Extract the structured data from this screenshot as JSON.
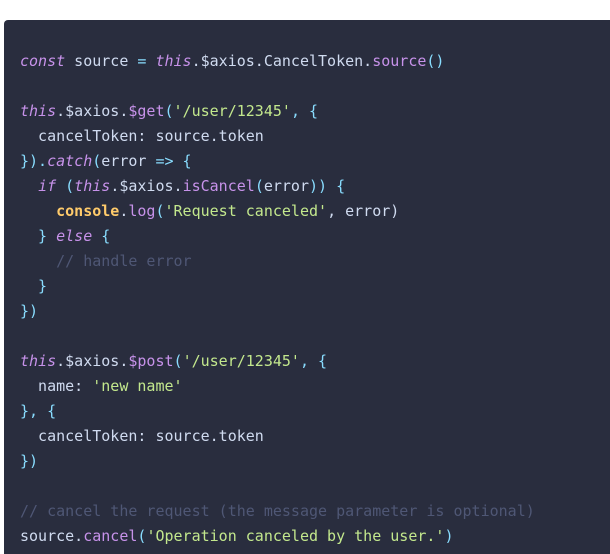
{
  "code": {
    "lines": [
      [
        {
          "t": "const",
          "c": "kw"
        },
        {
          "t": " source ",
          "c": "plain"
        },
        {
          "t": "=",
          "c": "op"
        },
        {
          "t": " ",
          "c": "plain"
        },
        {
          "t": "this",
          "c": "this"
        },
        {
          "t": ".$axios.CancelToken.",
          "c": "plain"
        },
        {
          "t": "source",
          "c": "fn"
        },
        {
          "t": "()",
          "c": "punc"
        }
      ],
      [],
      [
        {
          "t": "this",
          "c": "this"
        },
        {
          "t": ".$axios.",
          "c": "plain"
        },
        {
          "t": "$get",
          "c": "fn"
        },
        {
          "t": "(",
          "c": "punc"
        },
        {
          "t": "'/user/12345'",
          "c": "str"
        },
        {
          "t": ", {",
          "c": "punc"
        }
      ],
      [
        {
          "t": "  cancelToken: source.token",
          "c": "plain"
        }
      ],
      [
        {
          "t": "}).",
          "c": "punc"
        },
        {
          "t": "catch",
          "c": "kw"
        },
        {
          "t": "(",
          "c": "punc"
        },
        {
          "t": "error ",
          "c": "plain"
        },
        {
          "t": "=>",
          "c": "op"
        },
        {
          "t": " {",
          "c": "punc"
        }
      ],
      [
        {
          "t": "  ",
          "c": "plain"
        },
        {
          "t": "if",
          "c": "kw"
        },
        {
          "t": " (",
          "c": "punc"
        },
        {
          "t": "this",
          "c": "this"
        },
        {
          "t": ".$axios.",
          "c": "plain"
        },
        {
          "t": "isCancel",
          "c": "fn"
        },
        {
          "t": "(",
          "c": "punc"
        },
        {
          "t": "error",
          "c": "plain"
        },
        {
          "t": ")) {",
          "c": "punc"
        }
      ],
      [
        {
          "t": "    ",
          "c": "plain"
        },
        {
          "t": "console",
          "c": "console"
        },
        {
          "t": ".",
          "c": "plain"
        },
        {
          "t": "log",
          "c": "fn"
        },
        {
          "t": "(",
          "c": "punc"
        },
        {
          "t": "'Request canceled'",
          "c": "str"
        },
        {
          "t": ", error)",
          "c": "plain"
        }
      ],
      [
        {
          "t": "  } ",
          "c": "punc"
        },
        {
          "t": "else",
          "c": "kw"
        },
        {
          "t": " {",
          "c": "punc"
        }
      ],
      [
        {
          "t": "    // handle error",
          "c": "comment"
        }
      ],
      [
        {
          "t": "  }",
          "c": "punc"
        }
      ],
      [
        {
          "t": "})",
          "c": "punc"
        }
      ],
      [],
      [
        {
          "t": "this",
          "c": "this"
        },
        {
          "t": ".$axios.",
          "c": "plain"
        },
        {
          "t": "$post",
          "c": "fn"
        },
        {
          "t": "(",
          "c": "punc"
        },
        {
          "t": "'/user/12345'",
          "c": "str"
        },
        {
          "t": ", {",
          "c": "punc"
        }
      ],
      [
        {
          "t": "  name: ",
          "c": "plain"
        },
        {
          "t": "'new name'",
          "c": "str"
        }
      ],
      [
        {
          "t": "}, {",
          "c": "punc"
        }
      ],
      [
        {
          "t": "  cancelToken: source.token",
          "c": "plain"
        }
      ],
      [
        {
          "t": "})",
          "c": "punc"
        }
      ],
      [],
      [
        {
          "t": "// cancel the request (the message parameter is optional)",
          "c": "comment"
        }
      ],
      [
        {
          "t": "source.",
          "c": "plain"
        },
        {
          "t": "cancel",
          "c": "fn"
        },
        {
          "t": "(",
          "c": "punc"
        },
        {
          "t": "'Operation canceled by the user.'",
          "c": "str"
        },
        {
          "t": ")",
          "c": "punc"
        }
      ]
    ]
  },
  "colors": {
    "background": "#292d3e",
    "keyword": "#c792ea",
    "function": "#c792ea",
    "punctuation": "#89ddff",
    "string": "#c3e88d",
    "plain": "#d0dbf0",
    "comment": "#4f5775",
    "console": "#ffcb6b"
  }
}
